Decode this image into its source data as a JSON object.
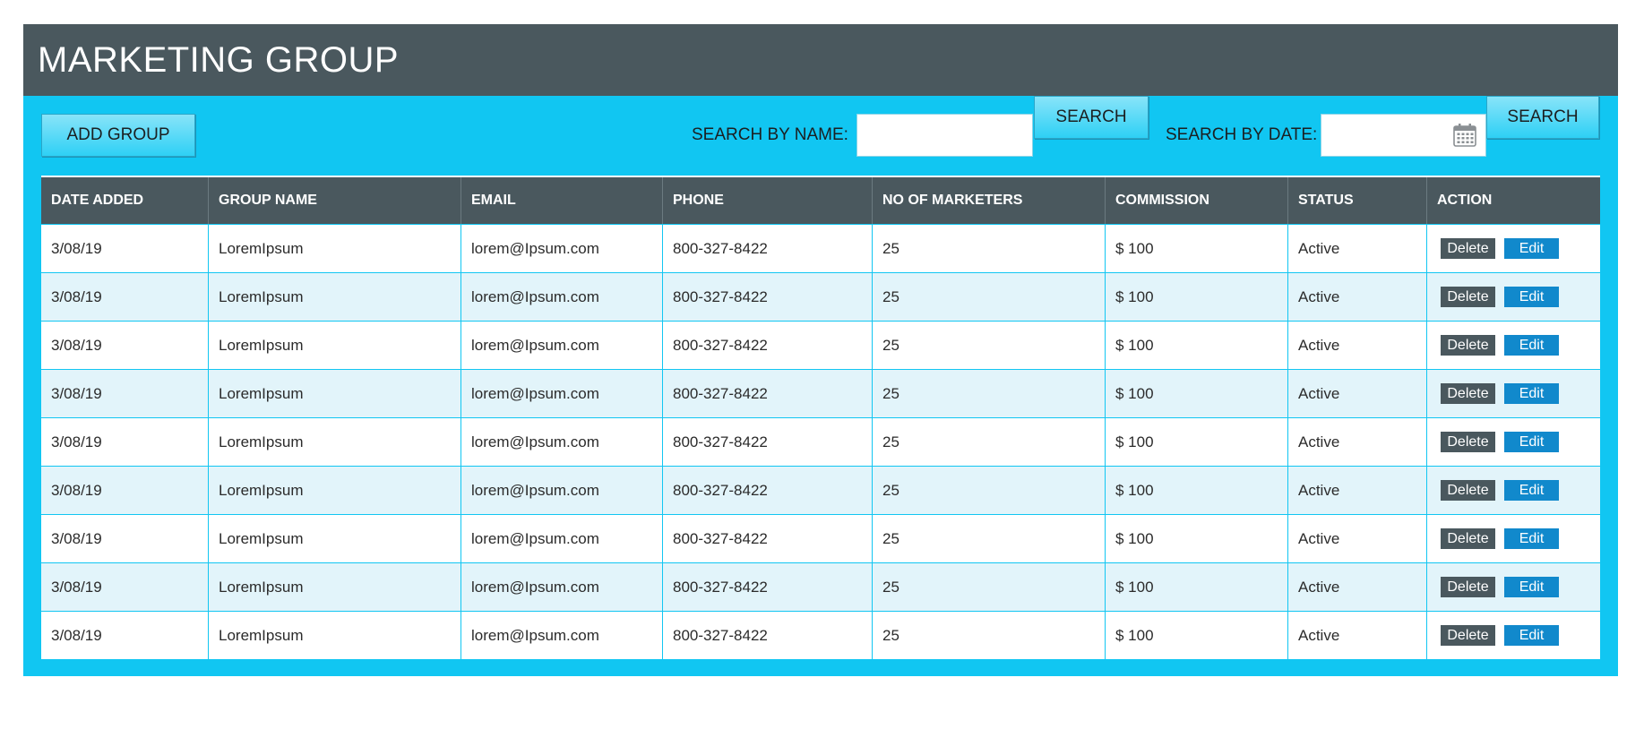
{
  "header": {
    "title": "MARKETING GROUP"
  },
  "toolbar": {
    "add_label": "ADD GROUP",
    "search_name_label": "SEARCH BY NAME:",
    "search_name_value": "",
    "search_button_1": "SEARCH",
    "search_date_label": "SEARCH BY DATE:",
    "search_date_value": "",
    "search_button_2": "SEARCH",
    "calendar_icon": "calendar-icon"
  },
  "table": {
    "columns": [
      "DATE ADDED",
      "GROUP NAME",
      "EMAIL",
      "PHONE",
      "NO OF MARKETERS",
      "COMMISSION",
      "STATUS",
      "ACTION"
    ],
    "rows": [
      {
        "date": "3/08/19",
        "group": "LoremIpsum",
        "email": "lorem@Ipsum.com",
        "phone": "800-327-8422",
        "marketers": "25",
        "commission": "$ 100",
        "status": "Active"
      },
      {
        "date": "3/08/19",
        "group": "LoremIpsum",
        "email": "lorem@Ipsum.com",
        "phone": "800-327-8422",
        "marketers": "25",
        "commission": "$ 100",
        "status": "Active"
      },
      {
        "date": "3/08/19",
        "group": "LoremIpsum",
        "email": "lorem@Ipsum.com",
        "phone": "800-327-8422",
        "marketers": "25",
        "commission": "$ 100",
        "status": "Active"
      },
      {
        "date": "3/08/19",
        "group": "LoremIpsum",
        "email": "lorem@Ipsum.com",
        "phone": "800-327-8422",
        "marketers": "25",
        "commission": "$ 100",
        "status": "Active"
      },
      {
        "date": "3/08/19",
        "group": "LoremIpsum",
        "email": "lorem@Ipsum.com",
        "phone": "800-327-8422",
        "marketers": "25",
        "commission": "$ 100",
        "status": "Active"
      },
      {
        "date": "3/08/19",
        "group": "LoremIpsum",
        "email": "lorem@Ipsum.com",
        "phone": "800-327-8422",
        "marketers": "25",
        "commission": "$ 100",
        "status": "Active"
      },
      {
        "date": "3/08/19",
        "group": "LoremIpsum",
        "email": "lorem@Ipsum.com",
        "phone": "800-327-8422",
        "marketers": "25",
        "commission": "$ 100",
        "status": "Active"
      },
      {
        "date": "3/08/19",
        "group": "LoremIpsum",
        "email": "lorem@Ipsum.com",
        "phone": "800-327-8422",
        "marketers": "25",
        "commission": "$ 100",
        "status": "Active"
      },
      {
        "date": "3/08/19",
        "group": "LoremIpsum",
        "email": "lorem@Ipsum.com",
        "phone": "800-327-8422",
        "marketers": "25",
        "commission": "$ 100",
        "status": "Active"
      }
    ],
    "delete_label": "Delete",
    "edit_label": "Edit"
  },
  "colors": {
    "panel": "#11c6f2",
    "header": "#4a585e",
    "row_alt": "#e2f4fa",
    "edit_button": "#1189cc",
    "delete_button": "#4a585e"
  }
}
